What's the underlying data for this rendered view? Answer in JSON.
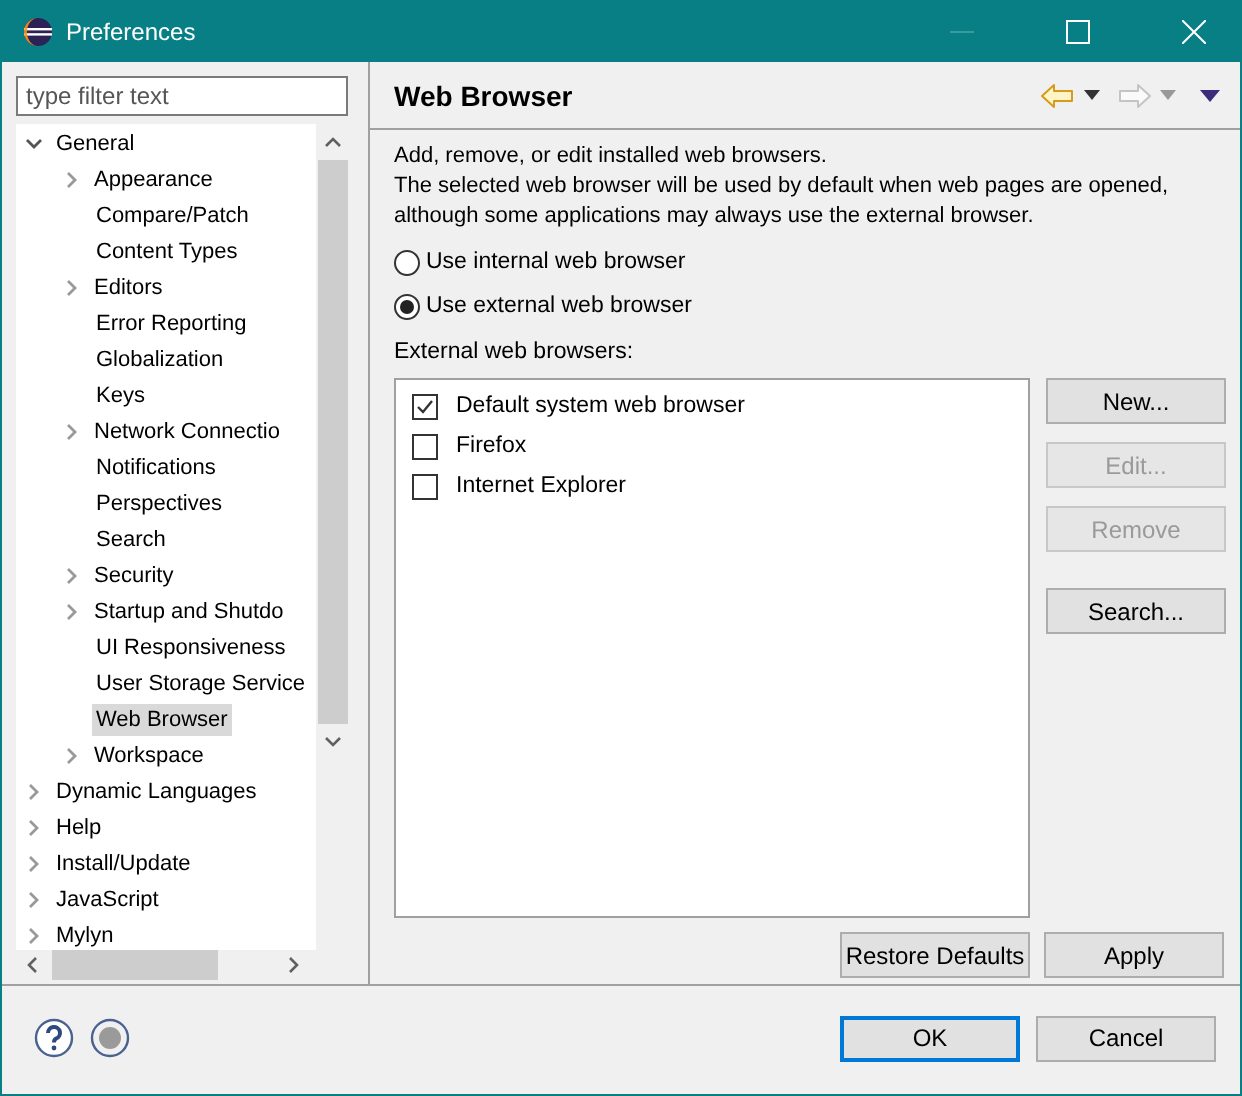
{
  "window": {
    "title": "Preferences"
  },
  "filter": {
    "placeholder": "type filter text"
  },
  "tree": [
    {
      "label": "General",
      "kind": "node",
      "expanded": true,
      "selected": false,
      "children": [
        {
          "label": "Appearance",
          "kind": "node",
          "expanded": false,
          "selected": false
        },
        {
          "label": "Compare/Patch",
          "kind": "leaf",
          "selected": false
        },
        {
          "label": "Content Types",
          "kind": "leaf",
          "selected": false
        },
        {
          "label": "Editors",
          "kind": "node",
          "expanded": false,
          "selected": false
        },
        {
          "label": "Error Reporting",
          "kind": "leaf",
          "selected": false
        },
        {
          "label": "Globalization",
          "kind": "leaf",
          "selected": false
        },
        {
          "label": "Keys",
          "kind": "leaf",
          "selected": false
        },
        {
          "label": "Network Connectio",
          "kind": "node",
          "expanded": false,
          "selected": false
        },
        {
          "label": "Notifications",
          "kind": "leaf",
          "selected": false
        },
        {
          "label": "Perspectives",
          "kind": "leaf",
          "selected": false
        },
        {
          "label": "Search",
          "kind": "leaf",
          "selected": false
        },
        {
          "label": "Security",
          "kind": "node",
          "expanded": false,
          "selected": false
        },
        {
          "label": "Startup and Shutdo",
          "kind": "node",
          "expanded": false,
          "selected": false
        },
        {
          "label": "UI Responsiveness",
          "kind": "leaf",
          "selected": false
        },
        {
          "label": "User Storage Service",
          "kind": "leaf",
          "selected": false
        },
        {
          "label": "Web Browser",
          "kind": "leaf",
          "selected": true
        },
        {
          "label": "Workspace",
          "kind": "node",
          "expanded": false,
          "selected": false
        }
      ]
    },
    {
      "label": "Dynamic Languages",
      "kind": "node",
      "expanded": false,
      "selected": false
    },
    {
      "label": "Help",
      "kind": "node",
      "expanded": false,
      "selected": false
    },
    {
      "label": "Install/Update",
      "kind": "node",
      "expanded": false,
      "selected": false
    },
    {
      "label": "JavaScript",
      "kind": "node",
      "expanded": false,
      "selected": false
    },
    {
      "label": "Mylyn",
      "kind": "node",
      "expanded": false,
      "selected": false
    }
  ],
  "page": {
    "title": "Web Browser",
    "back_enabled": true,
    "forward_enabled": false,
    "description": [
      "Add, remove, or edit installed web browsers.",
      "The selected web browser will be used by default when web pages are opened, although some applications may always use the external browser."
    ],
    "options": [
      {
        "label": "Use internal web browser",
        "selected": false
      },
      {
        "label": "Use external web browser",
        "selected": true
      }
    ],
    "list_label": "External web browsers:",
    "browsers": [
      {
        "label": "Default system web browser",
        "checked": true
      },
      {
        "label": "Firefox",
        "checked": false
      },
      {
        "label": "Internet Explorer",
        "checked": false
      }
    ],
    "side_buttons": [
      {
        "label": "New...",
        "disabled": false
      },
      {
        "label": "Edit...",
        "disabled": true
      },
      {
        "label": "Remove",
        "disabled": true
      },
      {
        "label": "Search...",
        "disabled": false
      }
    ],
    "page_buttons": [
      {
        "label": "Restore Defaults",
        "disabled": false
      },
      {
        "label": "Apply",
        "disabled": false
      }
    ]
  },
  "dialog_buttons": [
    {
      "label": "OK",
      "default": true
    },
    {
      "label": "Cancel",
      "default": false
    }
  ]
}
